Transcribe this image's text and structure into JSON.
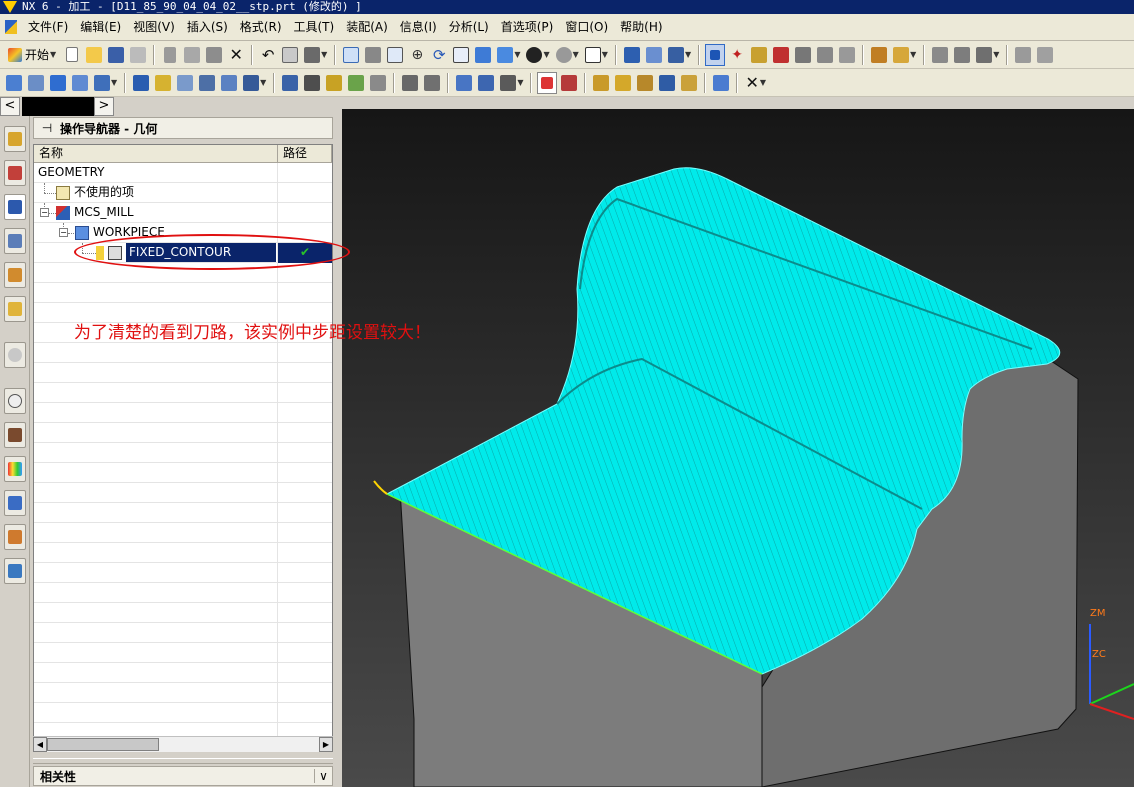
{
  "window": {
    "title": "NX 6 - 加工 - [D11_85_90_04_04_02__stp.prt (修改的) ]"
  },
  "menubar": {
    "items": [
      {
        "label": "文件(F)"
      },
      {
        "label": "编辑(E)"
      },
      {
        "label": "视图(V)"
      },
      {
        "label": "插入(S)"
      },
      {
        "label": "格式(R)"
      },
      {
        "label": "工具(T)"
      },
      {
        "label": "装配(A)"
      },
      {
        "label": "信息(I)"
      },
      {
        "label": "分析(L)"
      },
      {
        "label": "首选项(P)"
      },
      {
        "label": "窗口(O)"
      },
      {
        "label": "帮助(H)"
      }
    ]
  },
  "toolbar": {
    "start_label": "开始"
  },
  "navigator": {
    "title": "操作导航器 - 几何",
    "columns": {
      "name": "名称",
      "path": "路径"
    },
    "rows": [
      {
        "name": "GEOMETRY",
        "path": ""
      },
      {
        "name": "不使用的项",
        "path": ""
      },
      {
        "name": "MCS_MILL",
        "path": ""
      },
      {
        "name": "WORKPIECE",
        "path": ""
      },
      {
        "name": "FIXED_CONTOUR",
        "path": "✔"
      }
    ],
    "relations_title": "相关性"
  },
  "annotation": {
    "text": "为了清楚的看到刀路，该实例中步距设置较大！",
    "color": "#e01010"
  },
  "viewport": {
    "axis_labels": {
      "zm": "ZM",
      "zc": "ZC"
    },
    "toolpath_color": "#00ffff",
    "part_color": "#6e6e6e"
  }
}
